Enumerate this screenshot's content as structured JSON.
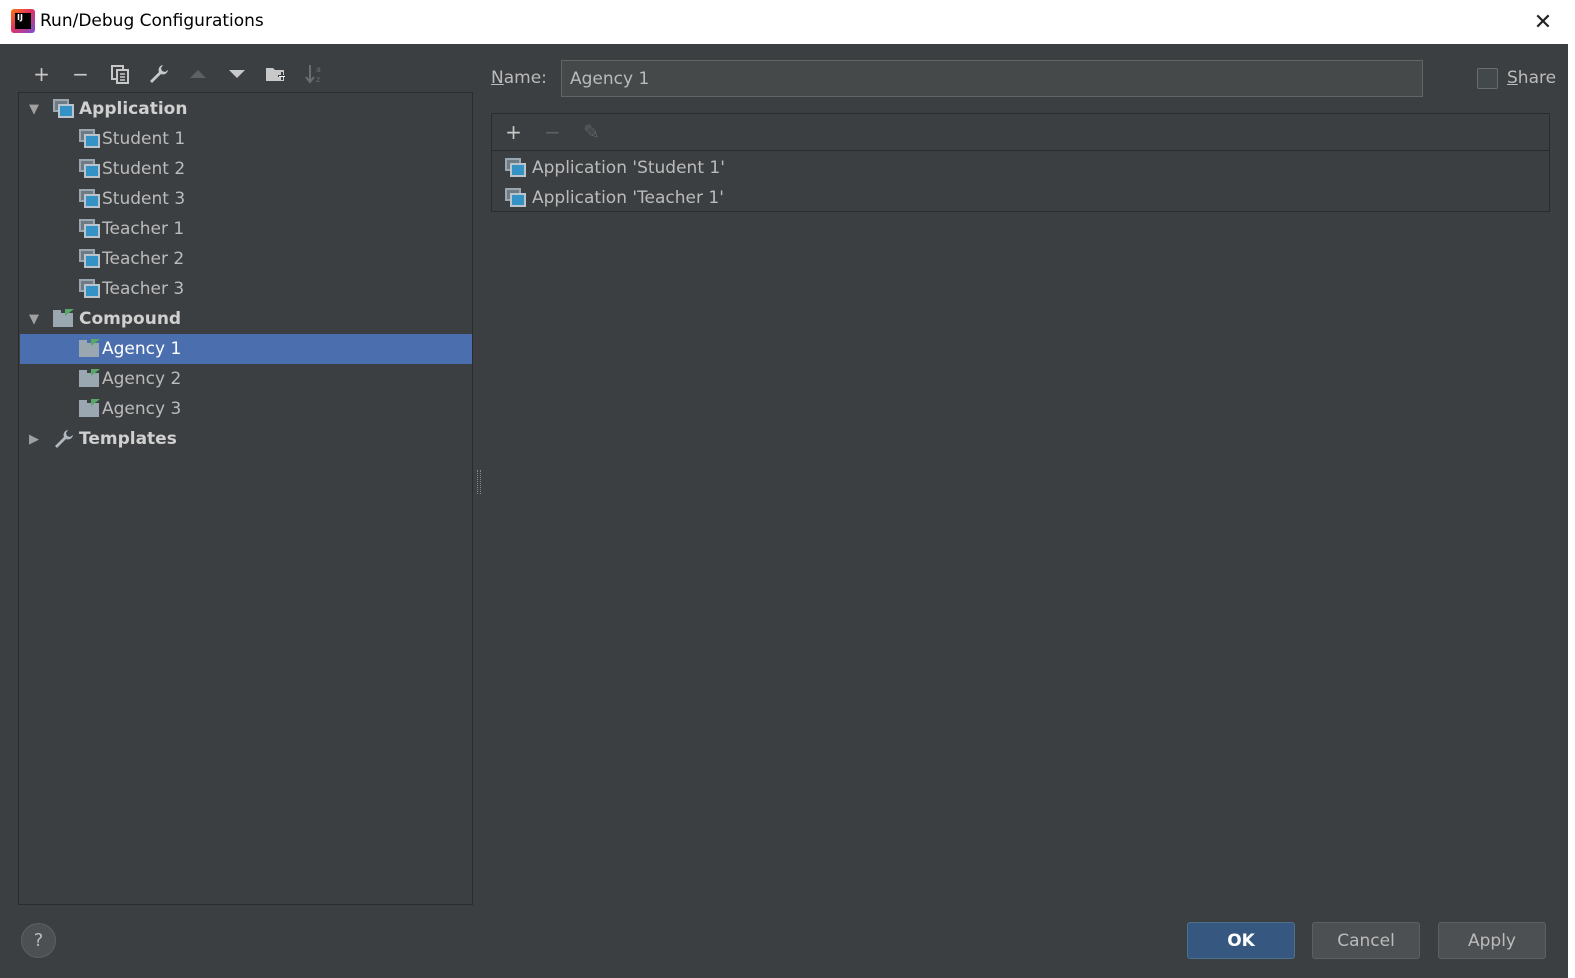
{
  "window": {
    "title": "Run/Debug Configurations",
    "logo_text": "IJ",
    "close_glyph": "✕"
  },
  "left_toolbar": {
    "add": "+",
    "remove": "−",
    "copy": "⧉",
    "edit_defaults": "🔧",
    "move_up": "▲",
    "move_down": "▼",
    "new_folder": "📁",
    "sort": "↓"
  },
  "tree": {
    "groups": [
      {
        "label": "Application",
        "expanded": true,
        "children": [
          "Student 1",
          "Student 2",
          "Student 3",
          "Teacher 1",
          "Teacher 2",
          "Teacher 3"
        ]
      },
      {
        "label": "Compound",
        "expanded": true,
        "children": [
          "Agency 1",
          "Agency 2",
          "Agency 3"
        ]
      },
      {
        "label": "Templates",
        "expanded": false,
        "children": []
      }
    ],
    "selected": "Agency 1"
  },
  "form": {
    "name_label_prefix": "N",
    "name_label_rest": "ame:",
    "name_value": "Agency 1",
    "share_label_prefix": "S",
    "share_label_rest": "hare",
    "share_checked": false
  },
  "list_toolbar": {
    "add": "+",
    "remove": "−",
    "edit": "✎"
  },
  "list_items": [
    "Application 'Student 1'",
    "Application 'Teacher 1'"
  ],
  "buttons": {
    "help": "?",
    "ok": "OK",
    "cancel": "Cancel",
    "apply": "Apply"
  },
  "colors": {
    "background": "#3c3f41",
    "selection": "#4b6eaf",
    "primary_button": "#365880",
    "compound_flag": "#59a869",
    "app_icon": "#3592c4"
  }
}
